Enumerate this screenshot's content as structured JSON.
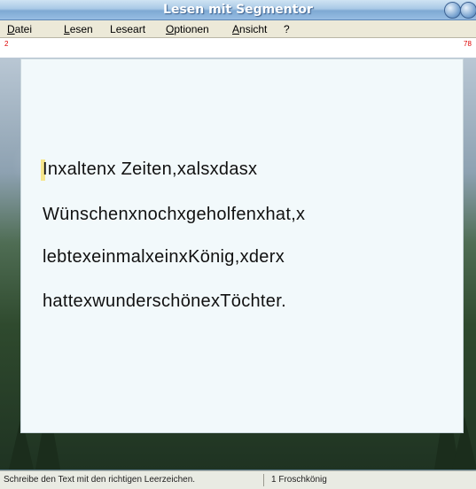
{
  "window": {
    "title": "Lesen mit Segmentor"
  },
  "menu": [
    {
      "label": "Datei",
      "u": "D",
      "rest": "atei"
    },
    {
      "label": "Lesen",
      "u": "L",
      "rest": "esen"
    },
    {
      "label": "Leseart",
      "u": "L",
      "rest": "eseart",
      "underline_index": 1
    },
    {
      "label": "Optionen",
      "u": "O",
      "rest": "ptionen"
    },
    {
      "label": "Ansicht",
      "u": "A",
      "rest": "nsicht"
    },
    {
      "label": "?"
    }
  ],
  "ruler": {
    "left": "2",
    "right": "78"
  },
  "text_lines": [
    "Inxaltenx Zeiten,xalsxdasx",
    "Wünschenxnochxgeholfenxhat,x",
    "lebtexeinmalxeinxKönig,xderx",
    "hattexwunderschönexTöchter."
  ],
  "status": {
    "message": "Schreibe den Text mit den richtigen Leerzeichen.",
    "story": "1 Froschkönig"
  }
}
